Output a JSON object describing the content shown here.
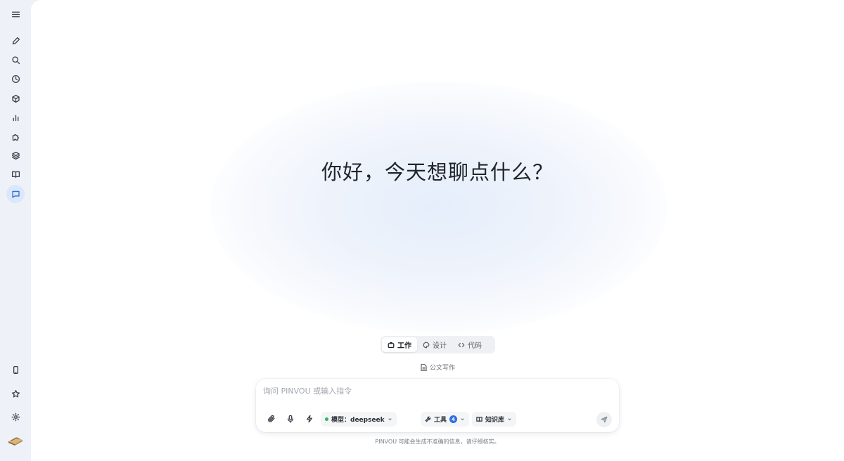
{
  "sidebar": {
    "top_items": [
      {
        "name": "menu",
        "icon": "menu-icon"
      },
      {
        "name": "new-chat",
        "icon": "pencil-icon"
      },
      {
        "name": "search",
        "icon": "search-icon"
      },
      {
        "name": "history",
        "icon": "clock-icon"
      },
      {
        "name": "package",
        "icon": "box-icon"
      },
      {
        "name": "stats",
        "icon": "bar-chart-icon"
      },
      {
        "name": "plugins",
        "icon": "puzzle-icon"
      },
      {
        "name": "layers",
        "icon": "layers-icon"
      },
      {
        "name": "library",
        "icon": "book-icon"
      },
      {
        "name": "chat",
        "icon": "message-icon",
        "active": true
      }
    ],
    "bottom_items": [
      {
        "name": "mobile",
        "icon": "phone-icon"
      },
      {
        "name": "favorites",
        "icon": "star-icon"
      },
      {
        "name": "settings",
        "icon": "gear-icon"
      }
    ]
  },
  "main": {
    "greeting": "你好，今天想聊点什么？",
    "mode_tabs": [
      {
        "label": "工作",
        "icon": "briefcase-icon",
        "active": true
      },
      {
        "label": "设计",
        "icon": "palette-icon",
        "active": false
      },
      {
        "label": "代码",
        "icon": "code-icon",
        "active": false
      }
    ],
    "subtool": {
      "label": "公文写作",
      "icon": "document-icon"
    },
    "composer": {
      "placeholder": "询问 PINVOU 或输入指令",
      "model_chip": {
        "label": "模型：deepseek",
        "status_color": "#22b86a"
      },
      "tools_chip": {
        "label": "工具",
        "count": "4"
      },
      "knowledge_chip": {
        "label": "知识库"
      }
    },
    "disclaimer": "PINVOU 可能会生成不准确的信息，请仔细核实。"
  },
  "colors": {
    "accent": "#2f6fe0",
    "sidebar_bg": "#eef1f7",
    "active_bg": "#dbe7fb"
  }
}
